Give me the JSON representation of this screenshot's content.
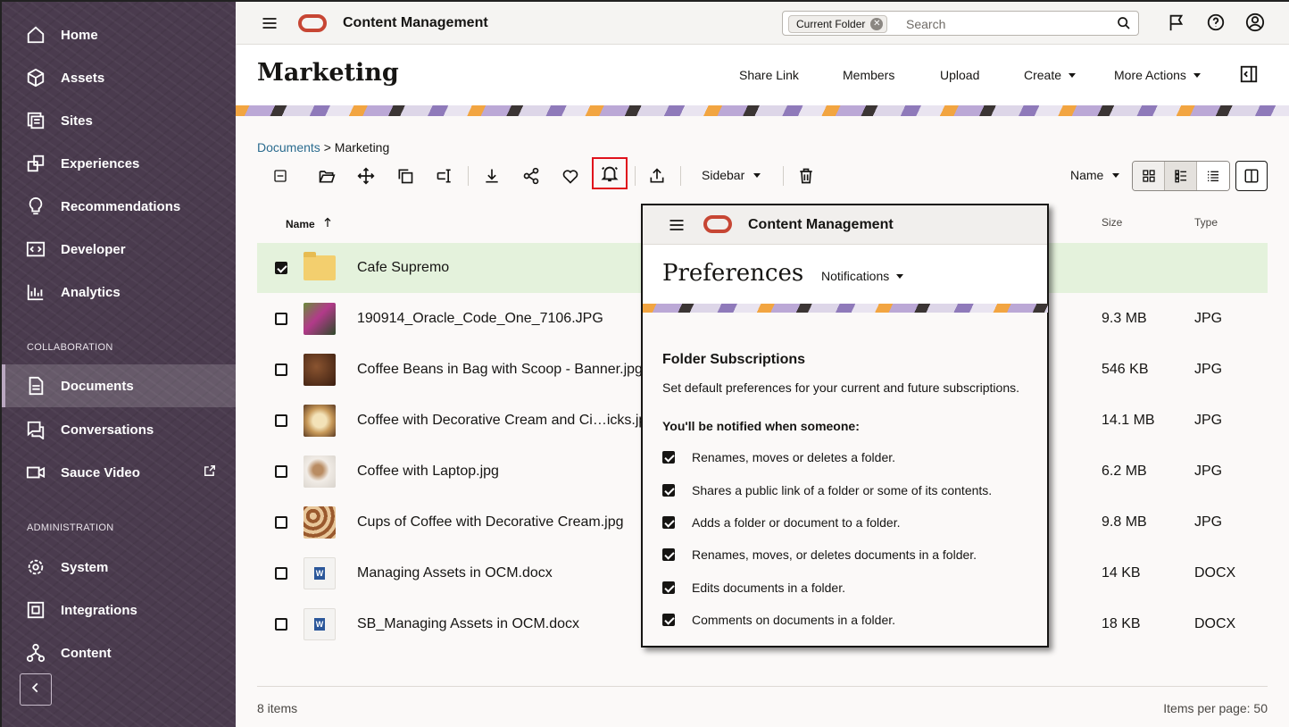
{
  "sidebar": {
    "items": [
      {
        "label": "Home",
        "icon": "home-icon"
      },
      {
        "label": "Assets",
        "icon": "cube-icon"
      },
      {
        "label": "Sites",
        "icon": "sites-icon"
      },
      {
        "label": "Experiences",
        "icon": "experiences-icon"
      },
      {
        "label": "Recommendations",
        "icon": "lightbulb-icon"
      },
      {
        "label": "Developer",
        "icon": "code-icon"
      },
      {
        "label": "Analytics",
        "icon": "analytics-icon"
      }
    ],
    "collaboration_label": "COLLABORATION",
    "collab_items": [
      {
        "label": "Documents",
        "icon": "documents-icon"
      },
      {
        "label": "Conversations",
        "icon": "conversations-icon"
      },
      {
        "label": "Sauce Video",
        "icon": "video-icon"
      }
    ],
    "administration_label": "ADMINISTRATION",
    "admin_items": [
      {
        "label": "System",
        "icon": "gear-icon"
      },
      {
        "label": "Integrations",
        "icon": "integrations-icon"
      },
      {
        "label": "Content",
        "icon": "content-icon"
      }
    ]
  },
  "header": {
    "app_title": "Content Management",
    "search_chip": "Current Folder",
    "search_placeholder": "Search"
  },
  "page": {
    "title": "Marketing",
    "actions": [
      "Share Link",
      "Members",
      "Upload",
      "Create",
      "More Actions"
    ]
  },
  "breadcrumb": {
    "parent": "Documents",
    "separator": ">",
    "current": "Marketing"
  },
  "toolbar": {
    "sidebar_label": "Sidebar",
    "sort_label": "Name"
  },
  "table": {
    "headers": {
      "name": "Name",
      "size": "Size",
      "type": "Type"
    },
    "rows": [
      {
        "name": "Cafe Supremo",
        "size": "",
        "type": "",
        "checked": true,
        "kind": "folder"
      },
      {
        "name": "190914_Oracle_Code_One_7106.JPG",
        "size": "9.3 MB",
        "type": "JPG",
        "checked": false,
        "kind": "image"
      },
      {
        "name": "Coffee Beans in Bag with Scoop - Banner.jpg",
        "size": "546 KB",
        "type": "JPG",
        "checked": false,
        "kind": "image"
      },
      {
        "name": "Coffee with Decorative Cream and Ci…icks.jpg",
        "size": "14.1 MB",
        "type": "JPG",
        "checked": false,
        "kind": "image"
      },
      {
        "name": "Coffee with Laptop.jpg",
        "size": "6.2 MB",
        "type": "JPG",
        "checked": false,
        "kind": "image"
      },
      {
        "name": "Cups of Coffee with Decorative Cream.jpg",
        "size": "9.8 MB",
        "type": "JPG",
        "checked": false,
        "kind": "image"
      },
      {
        "name": "Managing Assets in OCM.docx",
        "size": "14 KB",
        "type": "DOCX",
        "checked": false,
        "kind": "doc"
      },
      {
        "name": "SB_Managing Assets in OCM.docx",
        "size": "18 KB",
        "type": "DOCX",
        "checked": false,
        "kind": "doc"
      }
    ]
  },
  "footer": {
    "items_count": "8 items",
    "per_page": "Items per page: 50"
  },
  "preferences": {
    "app_title": "Content Management",
    "title": "Preferences",
    "dropdown": "Notifications",
    "section_title": "Folder Subscriptions",
    "section_desc": "Set default preferences for your current and future subscriptions.",
    "notified_label": "You'll be notified when someone:",
    "options": [
      "Renames, moves or deletes a folder.",
      "Shares a public link of a folder or some of its contents.",
      "Adds a folder or document to a folder.",
      "Renames, moves, or deletes documents in a folder.",
      "Edits documents in a folder.",
      "Comments on documents in a folder."
    ]
  },
  "colors": {
    "sidebar_bg": "#4a3b4e",
    "brand": "#c74634",
    "selected_row": "#e4f2dc",
    "highlight": "#e0121c"
  }
}
